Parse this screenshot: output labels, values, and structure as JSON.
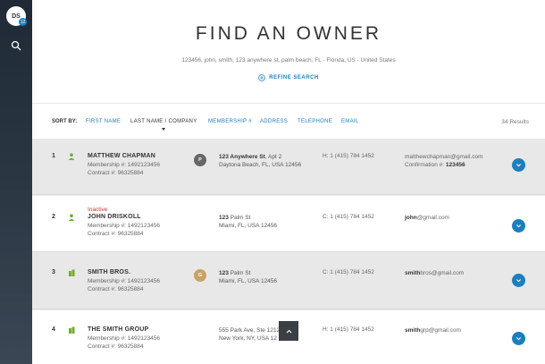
{
  "sidebar": {
    "avatar_initials": "DS",
    "badge_text": "12",
    "search_icon": "search-icon"
  },
  "header": {
    "title": "FIND AN OWNER",
    "criteria": "123456, john, smith, 123 anywhere st, palm beach, FL - Florida, US - United States",
    "refine_label": "REFINE SEARCH"
  },
  "sort": {
    "label": "SORT BY:",
    "options": [
      "FIRST NAME",
      "LAST NAME / COMPANY",
      "MEMBERSHIP #",
      "ADDRESS",
      "TELEPHONE",
      "EMAIL"
    ],
    "active_index": 1,
    "results": "34 Results"
  },
  "colors": {
    "accent": "#1a7fc1",
    "inactive": "#c0392b",
    "type_icon": "#6fae2c"
  },
  "rows": [
    {
      "num": "1",
      "type_icon": "person-icon",
      "status": "",
      "name": "MATTHEW CHAPMAN",
      "membership": "Membership #: 1492123456",
      "contract": "Contract #: 96325884",
      "pill": "P",
      "pill_color": "#666666",
      "addr_bold": "123 Anywhere St",
      "addr_rest": ", Apt 2",
      "addr_line2": "Daytona Beach, FL, USA 12456",
      "phone": "H: 1 (415) 784 1452",
      "email_bold": "",
      "email_rest": "matthewchapman@gmail.com",
      "confirm_label": "Confirmation #: ",
      "confirm_value": "123456"
    },
    {
      "num": "2",
      "type_icon": "person-icon",
      "status": "Inactive",
      "name": "JOHN DRISKOLL",
      "membership": "Membership #: 1492123456",
      "contract": "Contract #: 96325884",
      "pill": "",
      "pill_color": "",
      "addr_bold": "123",
      "addr_rest": " Palm St",
      "addr_line2": "Miami, FL, USA 12456",
      "phone": "C: 1 (415) 784 1452",
      "email_bold": "john",
      "email_rest": "@gmail.com",
      "confirm_label": "",
      "confirm_value": ""
    },
    {
      "num": "3",
      "type_icon": "building-icon",
      "status": "",
      "name": "SMITH BROS.",
      "membership": "Membership #: 1492123456",
      "contract": "Contract #: 96325884",
      "pill": "G",
      "pill_color": "#c9a265",
      "addr_bold": "123",
      "addr_rest": " Palm St",
      "addr_line2": "Miami, FL, USA 12456",
      "phone": "C: 1 (415) 784 1452",
      "email_bold": "smith",
      "email_rest": "bros@gmail.com",
      "confirm_label": "",
      "confirm_value": ""
    },
    {
      "num": "4",
      "type_icon": "building-icon",
      "status": "",
      "name": "THE SMITH GROUP",
      "membership": "Membership #: 1492123456",
      "contract": "Contract #: 96325884",
      "pill": "",
      "pill_color": "",
      "addr_bold": "",
      "addr_rest": "555 Park Ave, Ste 1212",
      "addr_line2": "New York, NY, USA 12",
      "phone": "H: 1 (415) 784 1452",
      "email_bold": "smith",
      "email_rest": "grp@gmail.com",
      "confirm_label": "",
      "confirm_value": ""
    }
  ],
  "back_to_top_icon": "chevron-up-icon"
}
